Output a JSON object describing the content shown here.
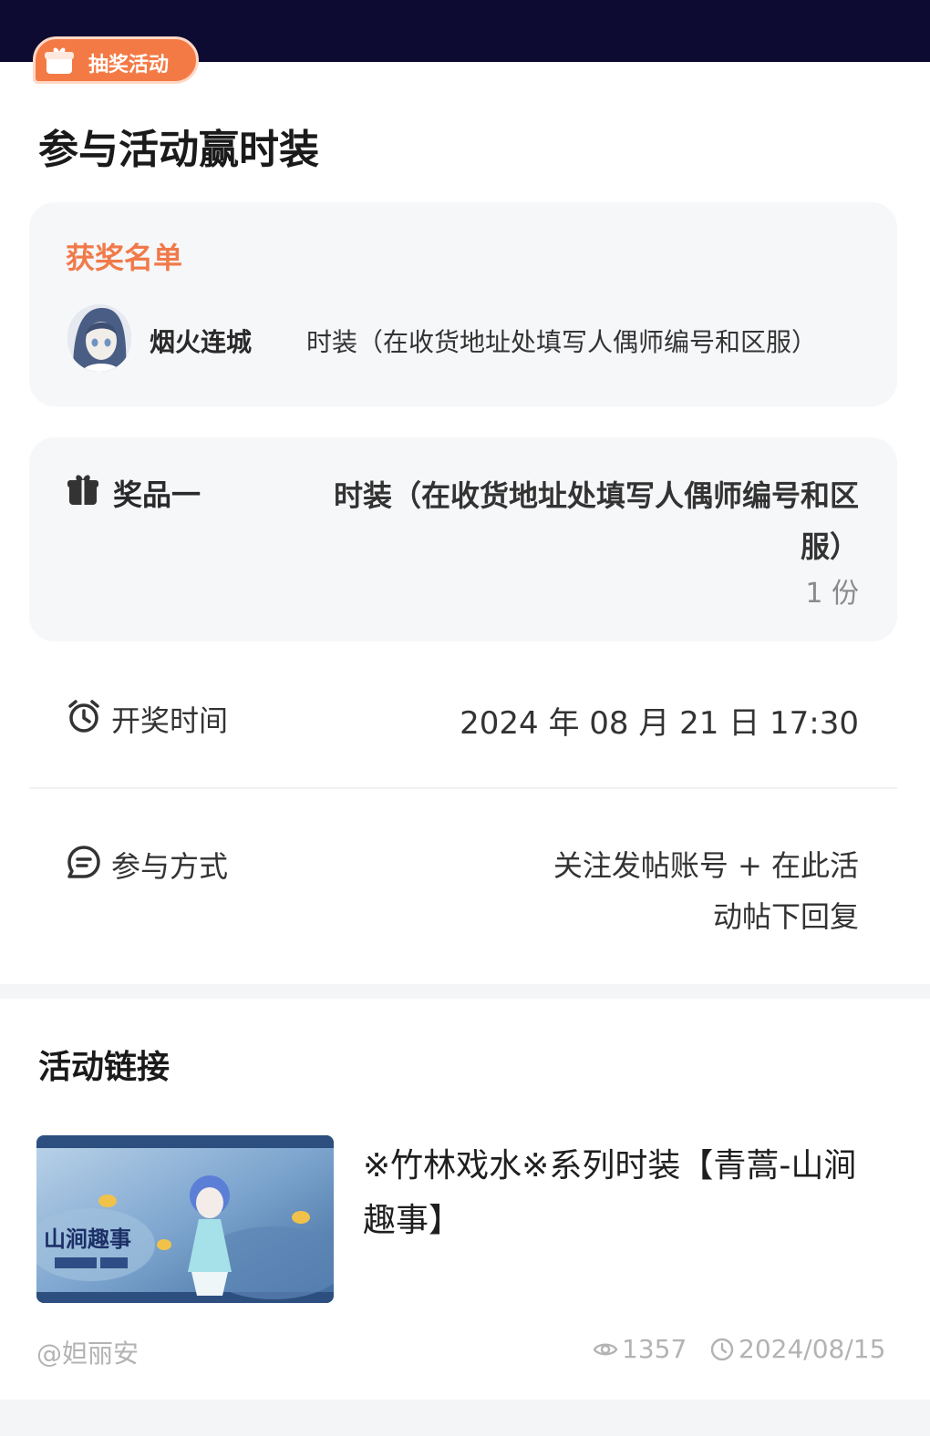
{
  "badge": {
    "label": "抽奖活动",
    "icon": "gift-icon",
    "color": "#f47a45"
  },
  "page_title": "参与活动赢时装",
  "winners": {
    "title": "获奖名单",
    "entries": [
      {
        "name": "烟火连城",
        "prize": "时装（在收货地址处填写人偶师编号和区服）",
        "avatar": "avatar"
      }
    ]
  },
  "prize": {
    "icon": "gift-icon",
    "label": "奖品一",
    "description": "时装（在收货地址处填写人偶师编号和区服）",
    "count": "1 份"
  },
  "draw_time": {
    "icon": "alarm-clock-icon",
    "label": "开奖时间",
    "value": "2024 年 08 月 21 日 17:30"
  },
  "join_method": {
    "icon": "chat-icon",
    "label": "参与方式",
    "value": "关注发帖账号 + 在此活动帖下回复"
  },
  "links": {
    "title": "活动链接",
    "post": {
      "title": "※竹林戏水※系列时装【青蒿-山涧趣事】",
      "thumbnail_text": "山涧趣事",
      "author": "@妲丽安",
      "views": "1357",
      "date": "2024/08/15"
    }
  },
  "colors": {
    "topbar": "#0e0b32",
    "accent": "#f07a4a",
    "card_bg": "#f6f7f9"
  }
}
